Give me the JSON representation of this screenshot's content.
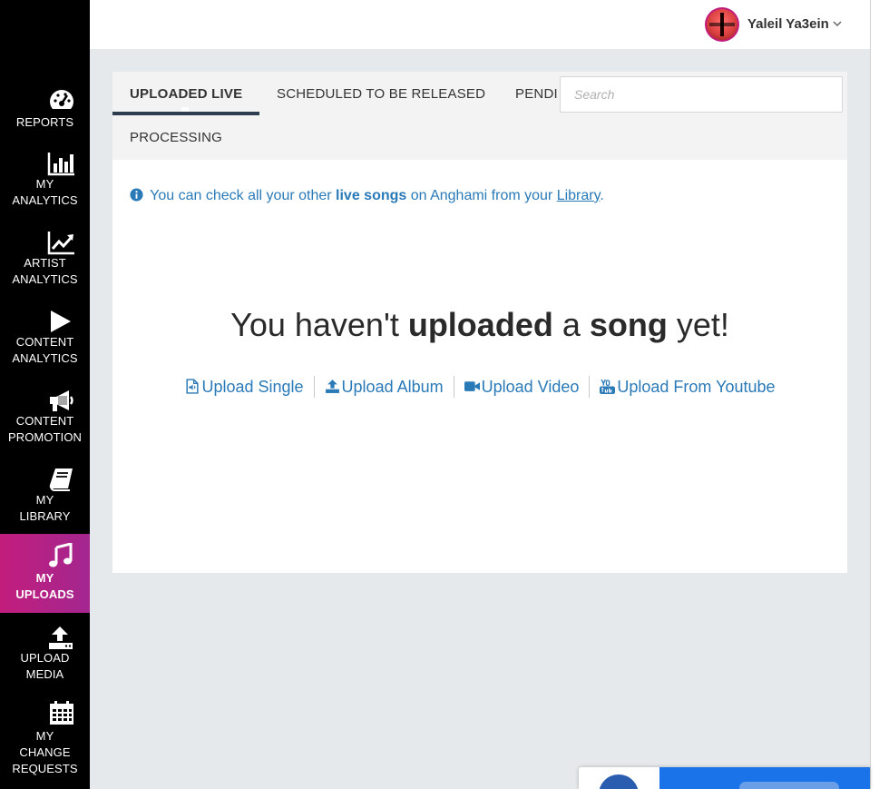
{
  "sidebar": {
    "items": [
      {
        "id": "reports",
        "icon": "dashboard-gauge-icon",
        "lines": [
          "REPORTS"
        ],
        "active": false
      },
      {
        "id": "my-analytics",
        "icon": "bar-chart-icon",
        "lines": [
          "MY",
          "ANALYTICS"
        ],
        "active": false
      },
      {
        "id": "artist-analytics",
        "icon": "line-chart-icon",
        "lines": [
          "ARTIST",
          "ANALYTICS"
        ],
        "active": false
      },
      {
        "id": "content-analytics",
        "icon": "play-icon",
        "lines": [
          "CONTENT",
          "ANALYTICS"
        ],
        "active": false
      },
      {
        "id": "content-promotion",
        "icon": "megaphone-icon",
        "lines": [
          "CONTENT",
          "PROMOTION"
        ],
        "active": false
      },
      {
        "id": "my-library",
        "icon": "book-icon",
        "lines": [
          "MY",
          "LIBRARY"
        ],
        "active": false
      },
      {
        "id": "my-uploads",
        "icon": "music-note-icon",
        "lines": [
          "MY",
          "UPLOADS"
        ],
        "active": true
      },
      {
        "id": "upload-media",
        "icon": "upload-tray-icon",
        "lines": [
          "UPLOAD",
          "MEDIA"
        ],
        "active": false
      },
      {
        "id": "my-change-requests",
        "icon": "calendar-icon",
        "lines": [
          "MY",
          "CHANGE",
          "REQUESTS"
        ],
        "active": false
      }
    ]
  },
  "header": {
    "username": "Yaleil Ya3ein",
    "avatar_icon": "user-avatar"
  },
  "tabs": [
    {
      "label": "UPLOADED LIVE",
      "active": true
    },
    {
      "label": "SCHEDULED TO BE RELEASED",
      "active": false
    },
    {
      "label": "PENDING",
      "active": false
    },
    {
      "label": "PROCESSING",
      "active": false
    }
  ],
  "search": {
    "placeholder": "Search",
    "value": ""
  },
  "info": {
    "prefix": "You can check all your other ",
    "emphasis": "live songs",
    "middle": " on Anghami from your ",
    "link": "Library",
    "suffix": "."
  },
  "empty_state": {
    "part1": "You haven't ",
    "bold1": "uploaded",
    "part2": " a ",
    "bold2": "song",
    "part3": " yet!"
  },
  "upload_actions": [
    {
      "label": "Upload Single",
      "icon": "audio-file-icon"
    },
    {
      "label": "Upload Album",
      "icon": "upload-icon"
    },
    {
      "label": "Upload Video",
      "icon": "video-camera-icon"
    },
    {
      "label": "Upload From Youtube",
      "icon": "youtube-icon"
    }
  ],
  "colors": {
    "sidebar_bg": "#000000",
    "active_nav": "#c21d7d",
    "accent_link": "#2a7ab8",
    "page_bg": "#e6e9eb"
  }
}
